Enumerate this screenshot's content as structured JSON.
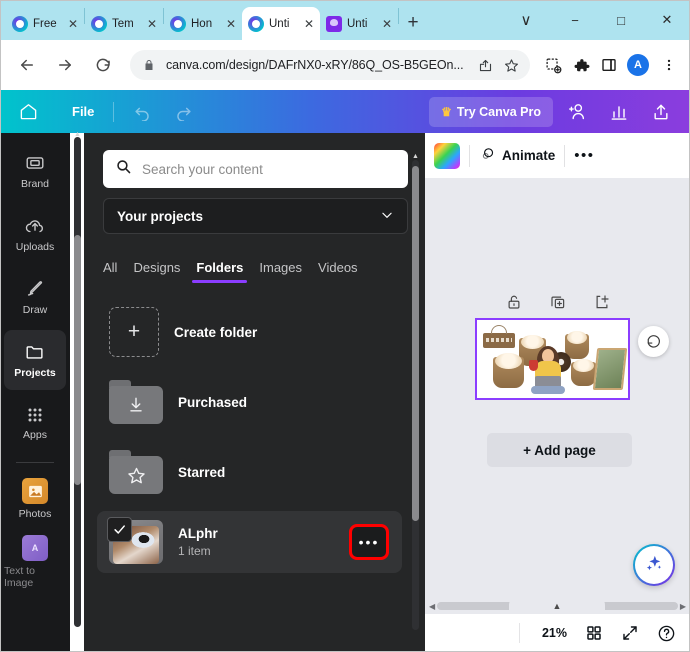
{
  "browser": {
    "tabs": [
      {
        "label": "Free",
        "icon": "canva-favicon",
        "active": false
      },
      {
        "label": "Tem",
        "icon": "canva-favicon",
        "active": false
      },
      {
        "label": "Hon",
        "icon": "canva-favicon",
        "active": false
      },
      {
        "label": "Unti",
        "icon": "canva-favicon",
        "active": true
      },
      {
        "label": "Unti",
        "icon": "purple-app-favicon",
        "active": false
      }
    ],
    "new_tab_label": "+",
    "window_controls": {
      "chevron": "∨",
      "minimize": "−",
      "maximize": "□",
      "close": "✕"
    },
    "nav": {
      "back": "←",
      "forward": "→",
      "reload": "⟳"
    },
    "omnibox": {
      "url": "canva.com/design/DAFrNX0-xRY/86Q_OS-B5GEOn...",
      "lock": "🔒"
    },
    "profile_initial": "A"
  },
  "canva_top": {
    "home_label": "home-icon",
    "file_label": "File",
    "undo_label": "undo-icon",
    "redo_label": "redo-icon",
    "try_pro_label": "Try Canva Pro",
    "crown": "♛"
  },
  "rail": {
    "items": [
      {
        "label": "Brand",
        "icon": "brand-icon",
        "active": false
      },
      {
        "label": "Uploads",
        "icon": "upload-cloud-icon",
        "active": false
      },
      {
        "label": "Draw",
        "icon": "pencil-icon",
        "active": false
      },
      {
        "label": "Projects",
        "icon": "folder-icon",
        "active": true
      },
      {
        "label": "Apps",
        "icon": "grid-dots-icon",
        "active": false
      },
      {
        "label": "Photos",
        "icon": "photos-icon",
        "active": false
      },
      {
        "label": "Text to Image",
        "icon": "text-to-image-icon",
        "active": false
      }
    ]
  },
  "panel": {
    "search_placeholder": "Search your content",
    "dropdown_value": "Your projects",
    "tabs": [
      {
        "label": "All",
        "active": false
      },
      {
        "label": "Designs",
        "active": false
      },
      {
        "label": "Folders",
        "active": true
      },
      {
        "label": "Images",
        "active": false
      },
      {
        "label": "Videos",
        "active": false
      }
    ],
    "rows": [
      {
        "title": "Create folder",
        "subtitle": "",
        "kind": "create",
        "icon": "plus-icon",
        "selected": false
      },
      {
        "title": "Purchased",
        "subtitle": "",
        "kind": "folder",
        "icon": "download-icon",
        "selected": false
      },
      {
        "title": "Starred",
        "subtitle": "",
        "kind": "folder",
        "icon": "star-icon",
        "selected": false
      },
      {
        "title": "ALphr",
        "subtitle": "1 item",
        "kind": "thumb",
        "icon": "checkbox-checked-icon",
        "selected": true
      }
    ],
    "more_label": "•••",
    "collapse_label": "‹"
  },
  "editor": {
    "animate_label": "Animate",
    "more_label": "•••",
    "page_tools": [
      {
        "icon": "lock-open-icon"
      },
      {
        "icon": "duplicate-page-icon"
      },
      {
        "icon": "add-page-icon"
      }
    ],
    "add_page_label": "+ Add page",
    "rotate_icon": "rotate-icon",
    "ai_icon": "sparkle-icon"
  },
  "status": {
    "zoom": "21%",
    "grid_icon": "grid-view-icon",
    "fullscreen_icon": "expand-icon",
    "help_icon": "help-icon"
  },
  "colors": {
    "canva_purple": "#8b3dff",
    "highlight_red": "#ff0000",
    "tabstrip_blue": "#aee3ef",
    "panel_bg": "#252627"
  }
}
